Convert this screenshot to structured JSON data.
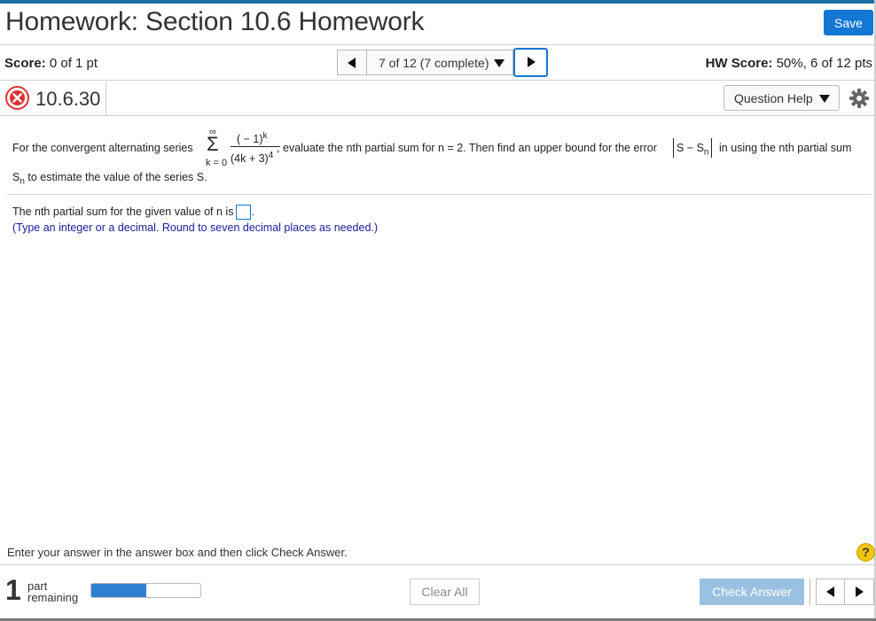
{
  "header": {
    "title": "Homework: Section 10.6 Homework",
    "save_label": "Save"
  },
  "score_bar": {
    "score_label": "Score:",
    "score_value": "0 of 1 pt",
    "nav_label": "7 of 12 (7 complete)",
    "hw_score_label": "HW Score:",
    "hw_score_value": "50%, 6 of 12 pts"
  },
  "question": {
    "number": "10.6.30",
    "help_label": "Question Help",
    "status_icon": "x-circle-icon",
    "text_intro": "For the convergent alternating series",
    "sigma_upper": "∞",
    "sigma_symbol": "Σ",
    "sigma_lower": "k = 0",
    "frac_num_base": "( − 1)",
    "frac_num_exp": "k",
    "frac_den_base": "(4k + 3)",
    "frac_den_exp": "4",
    "text_mid": ", evaluate the nth partial sum for n = 2. Then find an upper bound for the error",
    "abs_left": "S − S",
    "abs_sub": "n",
    "text_end": "in using the nth partial sum",
    "line2_s": "S",
    "line2_sub": "n",
    "line2_rest": "to estimate the value of the series S.",
    "answer_prompt": "The nth partial sum for the given value of n is",
    "answer_value": "",
    "answer_suffix": ".",
    "hint": "(Type an integer or a decimal. Round to seven decimal places as needed.)"
  },
  "footer": {
    "instructions": "Enter your answer in the answer box and then click Check Answer.",
    "help_symbol": "?",
    "parts_remaining_count": "1",
    "parts_remaining_line1": "part",
    "parts_remaining_line2": "remaining",
    "progress_fraction": 0.5,
    "clear_all_label": "Clear All",
    "check_answer_label": "Check Answer"
  },
  "colors": {
    "accent": "#1477d4",
    "top_bar": "#1a6fa3",
    "hint_text": "#1a1a9c",
    "error": "#e03030",
    "check_disabled": "#9bc1e2",
    "help_yellow": "#f1c40f"
  }
}
